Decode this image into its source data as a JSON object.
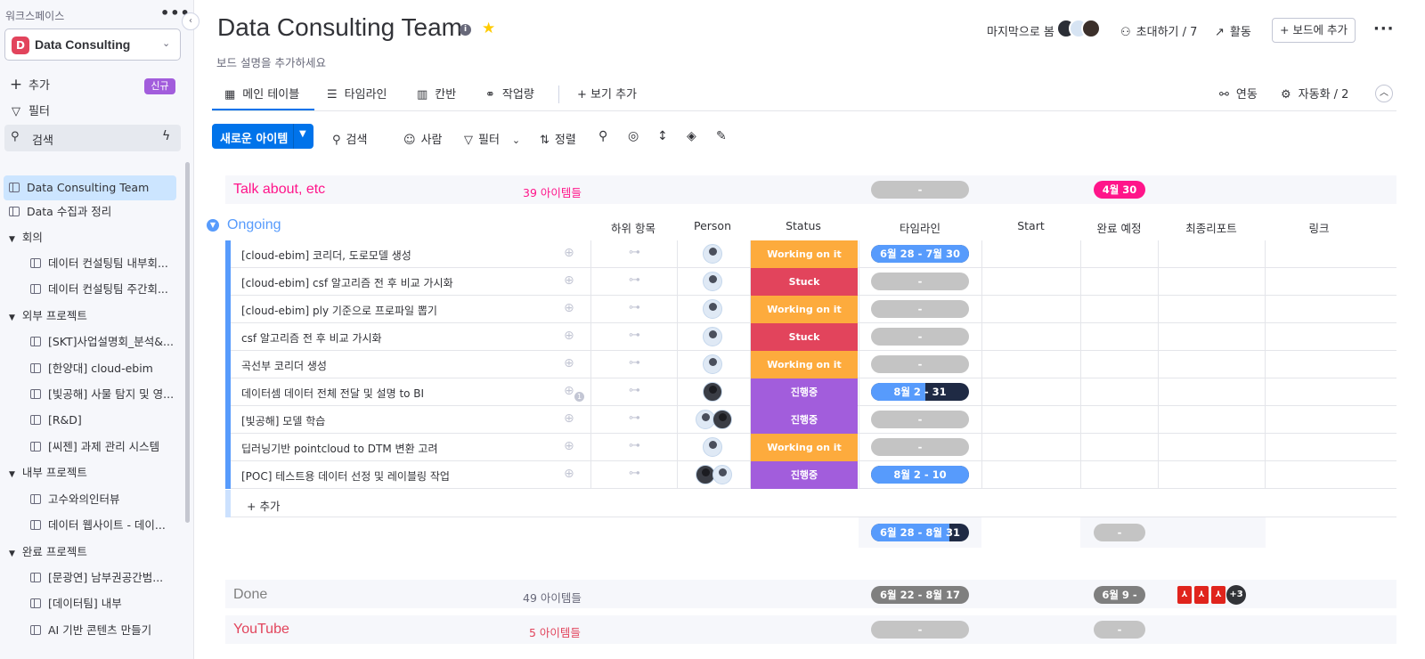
{
  "sidebar": {
    "workspace_label": "워크스페이스",
    "workspace_name": "Data Consulting",
    "workspace_initial": "D",
    "actions": {
      "add": "추가",
      "new_badge": "신규",
      "filter": "필터",
      "search": "검색"
    },
    "items": [
      {
        "label": "Data Consulting Team",
        "type": "board",
        "active": true
      },
      {
        "label": "Data 수집과 정리",
        "type": "board"
      },
      {
        "label": "회의",
        "type": "folder"
      },
      {
        "label": "데이터 컨설팅팀 내부회...",
        "type": "board"
      },
      {
        "label": "데이터 컨설팅팀 주간회...",
        "type": "board"
      },
      {
        "label": "외부 프로젝트",
        "type": "folder"
      },
      {
        "label": "[SKT]사업설명회_분석&...",
        "type": "board"
      },
      {
        "label": "[한양대] cloud-ebim",
        "type": "board"
      },
      {
        "label": "[빛공해] 사물 탐지 및 영...",
        "type": "board"
      },
      {
        "label": "[R&D]",
        "type": "board"
      },
      {
        "label": "[씨젠] 과제 관리 시스템",
        "type": "board"
      },
      {
        "label": "내부 프로젝트",
        "type": "folder"
      },
      {
        "label": "고수와의인터뷰",
        "type": "board"
      },
      {
        "label": "데이터 웹사이트 - 데이...",
        "type": "board"
      },
      {
        "label": "완료 프로젝트",
        "type": "folder"
      },
      {
        "label": "[문광연] 남부권공간범...",
        "type": "board"
      },
      {
        "label": "[데이터팀] 내부",
        "type": "board"
      },
      {
        "label": "AI 기반 콘텐츠 만들기",
        "type": "board"
      }
    ]
  },
  "header": {
    "title": "Data Consulting Team",
    "description": "보드 설명을 추가하세요",
    "last_seen": "마지막으로 봄",
    "invite": "초대하기 / 7",
    "activity": "활동",
    "add_to_board": "+ 보드에 추가"
  },
  "tabs": {
    "main_table": "메인 테이블",
    "timeline": "타임라인",
    "kanban": "칸반",
    "workload": "작업량",
    "add_view": "+ 보기 추가",
    "integrate": "연동",
    "automate": "자동화 / 2"
  },
  "toolbar": {
    "new_item": "새로운 아이템",
    "search": "검색",
    "person": "사람",
    "filter": "필터",
    "sort": "정렬"
  },
  "groups": {
    "talk": {
      "title": "Talk about, etc",
      "count": "39 아이템들",
      "timeline": "-",
      "due": "4월 30",
      "color": "#ff158a"
    },
    "ongoing": {
      "title": "Ongoing",
      "color": "#579bfc",
      "columns": [
        "하위 항목",
        "Person",
        "Status",
        "타임라인",
        "Start",
        "완료 예정",
        "최종리포트",
        "링크"
      ],
      "rows": [
        {
          "name": "[cloud-ebim] 코리더, 도로모델 생성",
          "status": "Working on it",
          "status_color": "#fdab3d",
          "timeline": "6월 28 - 7월 30",
          "tl_fill": 1.0,
          "people": [
            "male"
          ]
        },
        {
          "name": "[cloud-ebim] csf 알고리즘 전 후 비교 가시화",
          "status": "Stuck",
          "status_color": "#e2445c",
          "timeline": "-",
          "tl_fill": 0,
          "people": [
            "male"
          ]
        },
        {
          "name": "[cloud-ebim] ply 기준으로 프로파일 뽑기",
          "status": "Working on it",
          "status_color": "#fdab3d",
          "timeline": "-",
          "tl_fill": 0,
          "people": [
            "male"
          ]
        },
        {
          "name": "csf 알고리즘 전 후 비교 가시화",
          "status": "Stuck",
          "status_color": "#e2445c",
          "timeline": "-",
          "tl_fill": 0,
          "people": [
            "male"
          ]
        },
        {
          "name": "곡선부 코리더 생성",
          "status": "Working on it",
          "status_color": "#fdab3d",
          "timeline": "-",
          "tl_fill": 0,
          "people": [
            "male"
          ]
        },
        {
          "name": "데이터셈 데이터 전체 전달 및 설명 to BI",
          "status": "진행중",
          "status_color": "#a25ddc",
          "timeline": "8월 2 - 31",
          "tl_fill": 0.55,
          "people": [
            "female"
          ],
          "comment_count": "1"
        },
        {
          "name": "[빛공해] 모델 학습",
          "status": "진행중",
          "status_color": "#a25ddc",
          "timeline": "-",
          "tl_fill": 0,
          "people": [
            "male",
            "female"
          ]
        },
        {
          "name": "딥러닝기반 pointcloud to DTM 변환 고려",
          "status": "Working on it",
          "status_color": "#fdab3d",
          "timeline": "-",
          "tl_fill": 0,
          "people": [
            "male"
          ]
        },
        {
          "name": "[POC] 테스트용 데이터 선정 및 레이블링 작업",
          "status": "진행중",
          "status_color": "#a25ddc",
          "timeline": "8월 2 - 10",
          "tl_fill": 1.0,
          "people": [
            "female",
            "male"
          ]
        }
      ],
      "add_item": "+ 추가",
      "summary_timeline": "6월 28 - 8월 31",
      "summary_due": "-"
    },
    "done": {
      "title": "Done",
      "count": "49 아이템들",
      "timeline": "6월 22 - 8월 17",
      "due": "6월 9 - 7...",
      "files_more": "+3",
      "color": "#808080"
    },
    "youtube": {
      "title": "YouTube",
      "count": "5 아이템들",
      "timeline": "-",
      "due": "-",
      "color": "#e2445c"
    }
  }
}
